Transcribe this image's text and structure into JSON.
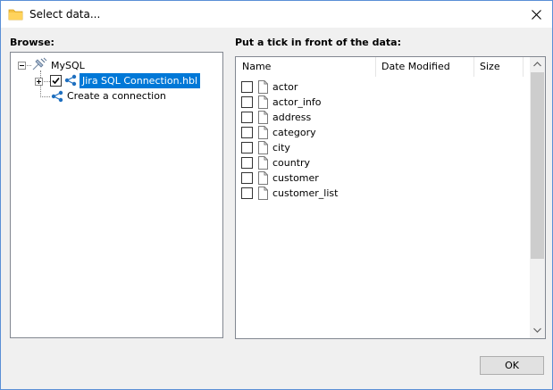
{
  "window": {
    "title": "Select data...",
    "icon": "folder-icon",
    "close_glyph": "✕"
  },
  "browse": {
    "label": "Browse:",
    "tree": {
      "root": {
        "label": "MySQL",
        "icon": "database-plug-icon",
        "expanded": true
      },
      "connection": {
        "label": "Jira SQL Connection.hbl",
        "icon": "share-icon",
        "checked": true,
        "selected": true,
        "expanded": false
      },
      "create": {
        "label": "Create a connection",
        "icon": "share-icon"
      }
    }
  },
  "data": {
    "label": "Put a tick in front of the data:",
    "columns": [
      "Name",
      "Date Modified",
      "Size"
    ],
    "rows": [
      {
        "name": "actor",
        "checked": false
      },
      {
        "name": "actor_info",
        "checked": false
      },
      {
        "name": "address",
        "checked": false
      },
      {
        "name": "category",
        "checked": false
      },
      {
        "name": "city",
        "checked": false
      },
      {
        "name": "country",
        "checked": false
      },
      {
        "name": "customer",
        "checked": false
      },
      {
        "name": "customer_list",
        "checked": false
      }
    ]
  },
  "buttons": {
    "ok": "OK"
  },
  "colors": {
    "selection": "#0078d7",
    "folder": "#f5c243",
    "share_icon": "#1e6fbf",
    "window_border": "#5a8fd6"
  }
}
